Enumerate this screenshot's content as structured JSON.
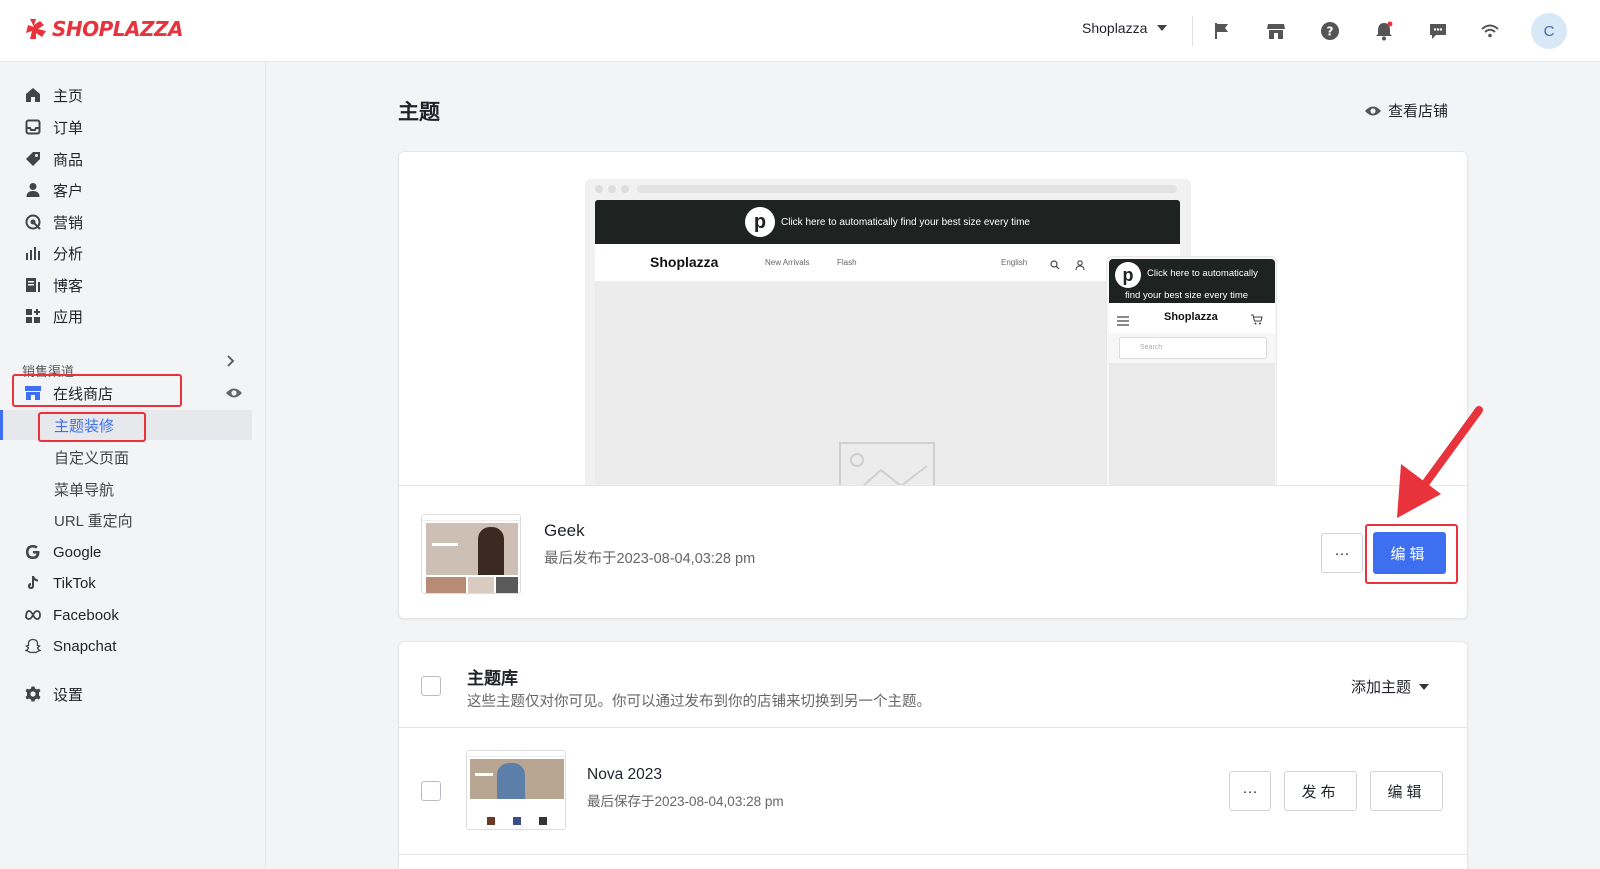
{
  "brand": {
    "name": "SHOPLAZZA",
    "accent": "#e8323c",
    "primary": "#3d6ff0"
  },
  "topbar": {
    "store_name": "Shoplazza",
    "avatar_letter": "C"
  },
  "sidebar": {
    "items": [
      {
        "label": "主页",
        "icon": "home-icon"
      },
      {
        "label": "订单",
        "icon": "inbox-icon"
      },
      {
        "label": "商品",
        "icon": "tag-icon"
      },
      {
        "label": "客户",
        "icon": "person-icon"
      },
      {
        "label": "营销",
        "icon": "marketing-icon"
      },
      {
        "label": "分析",
        "icon": "bar-chart-icon"
      },
      {
        "label": "博客",
        "icon": "blog-icon"
      },
      {
        "label": "应用",
        "icon": "apps-icon"
      }
    ],
    "section_title": "销售渠道",
    "online_store": "在线商店",
    "sub_items": [
      "主题装修",
      "自定义页面",
      "菜单导航",
      "URL 重定向"
    ],
    "channels": [
      {
        "label": "Google",
        "icon": "google-icon"
      },
      {
        "label": "TikTok",
        "icon": "tiktok-icon"
      },
      {
        "label": "Facebook",
        "icon": "meta-icon"
      },
      {
        "label": "Snapchat",
        "icon": "snapchat-icon"
      }
    ],
    "settings": "设置"
  },
  "main": {
    "title": "主题",
    "view_store": "查看店铺",
    "preview": {
      "banner_text": "Click here to automatically find your best size every time",
      "mobile_banner_line1": "Click here to automatically",
      "mobile_banner_line2": "find your best size every time",
      "store_brand": "Shoplazza",
      "nav_links": [
        "New Arrivals",
        "Flash"
      ],
      "language": "English",
      "search_placeholder": "Search"
    },
    "current_theme": {
      "name": "Geek",
      "subtitle": "最后发布于2023-08-04,03:28 pm",
      "more_label": "···",
      "edit_label": "编辑"
    },
    "library": {
      "title": "主题库",
      "description": "这些主题仅对你可见。你可以通过发布到你的店铺来切换到另一个主题。",
      "add_theme": "添加主题",
      "themes": [
        {
          "name": "Nova 2023",
          "subtitle": "最后保存于2023-08-04,03:28 pm",
          "more_label": "···",
          "publish_label": "发布",
          "edit_label": "编辑"
        }
      ]
    }
  }
}
